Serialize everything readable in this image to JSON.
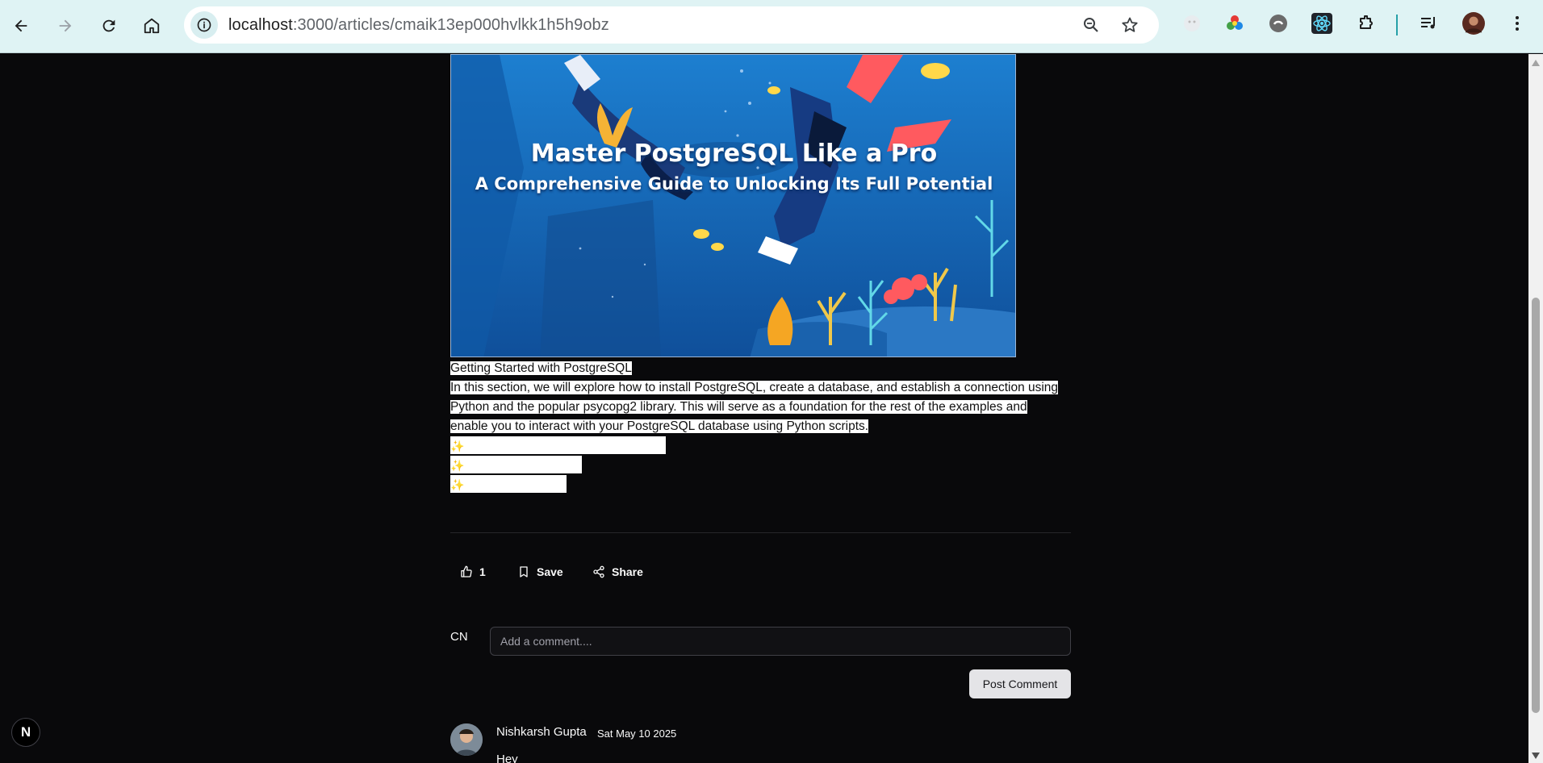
{
  "browser": {
    "url_host": "localhost",
    "url_path": ":3000/articles/cmaik13ep000hvlkk1h5h9obz"
  },
  "hero": {
    "title": "Master PostgreSQL Like a Pro",
    "subtitle": "A Comprehensive Guide to Unlocking Its Full Potential"
  },
  "article": {
    "heading": "Getting Started with PostgreSQL",
    "paragraph_lines": [
      "In this section, we will explore how to install PostgreSQL, create a database, and establish a connection using",
      "Python and the popular psycopg2 library. This will serve as a foundation for the rest of the examples and",
      "enable you to interact with your PostgreSQL database using Python scripts."
    ],
    "sparkle": "✨"
  },
  "actions": {
    "like_count": "1",
    "save_label": "Save",
    "share_label": "Share"
  },
  "comment_form": {
    "user_initials": "CN",
    "placeholder": "Add a comment....",
    "post_label": "Post Comment"
  },
  "comments": [
    {
      "author": "Nishkarsh Gupta",
      "date": "Sat May 10 2025",
      "text": "Hey"
    }
  ],
  "dev_badge": "N"
}
